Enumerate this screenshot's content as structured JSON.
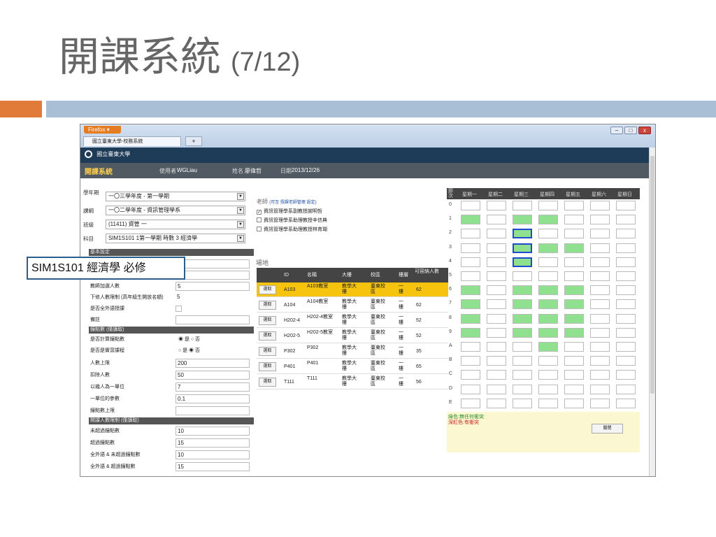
{
  "slide": {
    "title": "開課系統",
    "number": "(7/12)"
  },
  "browser": {
    "menu": "Firefox ▾",
    "tab_title": "國立臺東大學-校務系統",
    "new_tab": "+",
    "controls": {
      "minimize": "–",
      "maximize": "□",
      "close": "x"
    }
  },
  "site": {
    "logo_text": "國立臺東大學"
  },
  "nav": {
    "app_name": "開課系統",
    "user_label": "使用者",
    "user_value": "WGLiau",
    "name_label": "姓名",
    "name_value": "廖偉哲",
    "date_label": "日期",
    "date_value": "2013/12/26"
  },
  "selectors": [
    {
      "label": "學年期",
      "value": "一〇三學年度 - 第一學期"
    },
    {
      "label": "課綱",
      "value": "一〇二學年度 - 資訊管理學系"
    },
    {
      "label": "班級",
      "value": "(11411) 資管 一"
    },
    {
      "label": "科目",
      "value": "SIM1S101 1第一學期 時數 3 經濟學"
    }
  ],
  "teachers": {
    "label": "老師",
    "note": "(可至 授課老師管理 設定)",
    "items": [
      {
        "name": "資訊管理學系副教授謝明哲",
        "checked": true
      },
      {
        "name": "資訊管理學系助理教授辛信典",
        "checked": false
      },
      {
        "name": "資訊管理學系助理教授林育瑚",
        "checked": false
      }
    ]
  },
  "basic_settings": {
    "header": "基本設定",
    "rows": [
      {
        "label": "教師加選人數",
        "value": "5"
      },
      {
        "label": "下修人數限制 (高年級生開放名額)",
        "value": "5"
      },
      {
        "label": "是否全外語授課",
        "value": ""
      },
      {
        "label": "備註",
        "value": ""
      }
    ]
  },
  "points_section": {
    "header": "鐘點數 (僅讀取)",
    "rows": [
      {
        "label": "是否計算鐘點數",
        "radio": "◉ 是  ○ 否"
      },
      {
        "label": "是否是實習課程",
        "radio": "○ 是  ◉ 否"
      },
      {
        "label": "人數上限",
        "value": "200"
      },
      {
        "label": "扣除人數",
        "value": "50"
      },
      {
        "label": "以幾人為一單位",
        "value": "7"
      },
      {
        "label": "一單位的參數",
        "value": "0.1"
      },
      {
        "label": "鐘點數上限",
        "value": ""
      }
    ]
  },
  "enrollment_section": {
    "header": "開課人數限制 (僅讀取)",
    "rows": [
      {
        "label": "未超過鐘點數",
        "value": "10"
      },
      {
        "label": "超過鐘點數",
        "value": "15"
      },
      {
        "label": "全外語 & 未超過鐘點數",
        "value": "10"
      },
      {
        "label": "全外語 & 超過鐘點數",
        "value": "15"
      }
    ]
  },
  "callout": "SIM1S101 經濟學 必修",
  "rooms": {
    "title": "場地",
    "headers": [
      "ID",
      "名稱",
      "大樓",
      "校區",
      "樓層",
      "可容納人數"
    ],
    "pick_label": "選取",
    "rows": [
      {
        "id": "A103",
        "name": "A103教室",
        "building": "教學大樓",
        "campus": "臺東校區",
        "floor": "一樓",
        "cap": "62",
        "selected": true
      },
      {
        "id": "A104",
        "name": "A104教室",
        "building": "教學大樓",
        "campus": "臺東校區",
        "floor": "一樓",
        "cap": "62"
      },
      {
        "id": "H202-4",
        "name": "H202-4教室",
        "building": "教學大樓",
        "campus": "臺東校區",
        "floor": "一樓",
        "cap": "52"
      },
      {
        "id": "H202-5",
        "name": "H202-5教室",
        "building": "教學大樓",
        "campus": "臺東校區",
        "floor": "一樓",
        "cap": "52"
      },
      {
        "id": "P302",
        "name": "P302",
        "building": "教學大樓",
        "campus": "臺東校區",
        "floor": "一樓",
        "cap": "35"
      },
      {
        "id": "P401",
        "name": "P401",
        "building": "教學大樓",
        "campus": "臺東校區",
        "floor": "一樓",
        "cap": "65"
      },
      {
        "id": "T111",
        "name": "T111",
        "building": "教學大樓",
        "campus": "臺東校區",
        "floor": "一樓",
        "cap": "56"
      }
    ]
  },
  "schedule": {
    "period_header": "節次",
    "days": [
      "星期一",
      "星期二",
      "星期三",
      "星期四",
      "星期五",
      "星期六",
      "星期日"
    ],
    "periods": [
      "0",
      "1",
      "2",
      "3",
      "4",
      "5",
      "6",
      "7",
      "8",
      "9",
      "A",
      "B",
      "C",
      "D",
      "E"
    ],
    "free_color": "#8fe08f",
    "cells": [
      "0000000",
      "1011000",
      "00b0000",
      "00b1100",
      "00b0000",
      "0000000",
      "1011100",
      "1011100",
      "1011100",
      "1011100",
      "0001000",
      "0000000",
      "0000000",
      "0000000",
      "0000000"
    ],
    "legend_green": "綠色:無任何衝突",
    "legend_red": "深紅色:有衝突",
    "close_label": "關閉"
  }
}
